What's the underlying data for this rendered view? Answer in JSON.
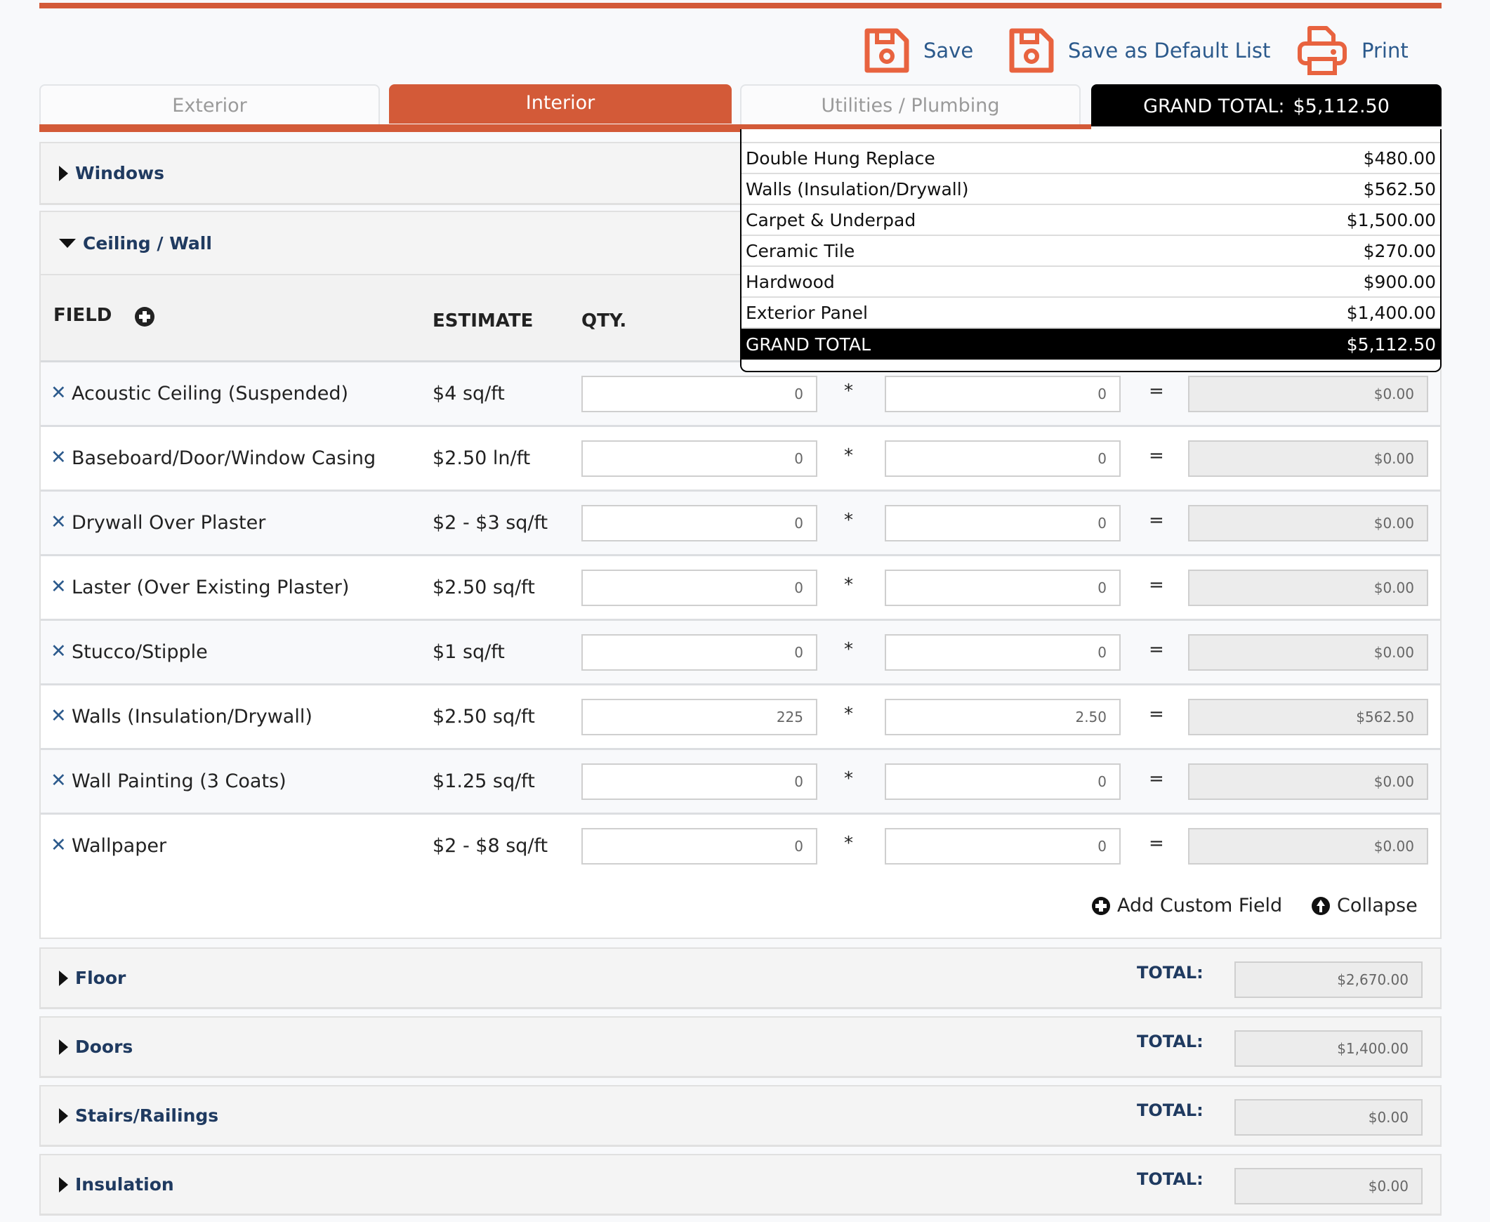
{
  "toolbar": {
    "save_label": "Save",
    "save_default_label": "Save as Default List",
    "print_label": "Print"
  },
  "colors": {
    "accent": "#d35a38",
    "link": "#2c5a8c",
    "heading": "#1f3a60"
  },
  "tabs": [
    {
      "label": "Exterior",
      "active": false
    },
    {
      "label": "Interior",
      "active": true
    },
    {
      "label": "Utilities / Plumbing",
      "active": false
    }
  ],
  "grand_total": {
    "label": "GRAND TOTAL:",
    "value": "$5,112.50"
  },
  "summary_popup": {
    "items": [
      {
        "name": "Double Hung Replace",
        "amount": "$480.00"
      },
      {
        "name": "Walls (Insulation/Drywall)",
        "amount": "$562.50"
      },
      {
        "name": "Carpet & Underpad",
        "amount": "$1,500.00"
      },
      {
        "name": "Ceramic Tile",
        "amount": "$270.00"
      },
      {
        "name": "Hardwood",
        "amount": "$900.00"
      },
      {
        "name": "Exterior Panel",
        "amount": "$1,400.00"
      }
    ],
    "total_label": "GRAND TOTAL",
    "total_value": "$5,112.50"
  },
  "sections": {
    "windows": {
      "title": "Windows"
    },
    "ceiling_wall": {
      "title": "Ceiling / Wall",
      "headers": {
        "field": "FIELD",
        "estimate": "ESTIMATE",
        "qty": "QTY."
      },
      "rows": [
        {
          "name": "Acoustic Ceiling (Suspended)",
          "estimate": "$4 sq/ft",
          "qty": "0",
          "price": "0",
          "total": "$0.00"
        },
        {
          "name": "Baseboard/Door/Window Casing",
          "estimate": "$2.50 ln/ft",
          "qty": "0",
          "price": "0",
          "total": "$0.00"
        },
        {
          "name": "Drywall Over Plaster",
          "estimate": "$2 - $3 sq/ft",
          "qty": "0",
          "price": "0",
          "total": "$0.00"
        },
        {
          "name": "Laster (Over Existing Plaster)",
          "estimate": "$2.50 sq/ft",
          "qty": "0",
          "price": "0",
          "total": "$0.00"
        },
        {
          "name": "Stucco/Stipple",
          "estimate": "$1 sq/ft",
          "qty": "0",
          "price": "0",
          "total": "$0.00"
        },
        {
          "name": "Walls (Insulation/Drywall)",
          "estimate": "$2.50 sq/ft",
          "qty": "225",
          "price": "2.50",
          "total": "$562.50"
        },
        {
          "name": "Wall Painting (3 Coats)",
          "estimate": "$1.25 sq/ft",
          "qty": "0",
          "price": "0",
          "total": "$0.00"
        },
        {
          "name": "Wallpaper",
          "estimate": "$2 - $8 sq/ft",
          "qty": "0",
          "price": "0",
          "total": "$0.00"
        }
      ],
      "operators": {
        "multiply": "*",
        "equals": "="
      },
      "add_custom_label": "Add Custom Field",
      "collapse_label": "Collapse"
    },
    "collapsed": [
      {
        "title": "Floor",
        "total_label": "TOTAL:",
        "total": "$2,670.00"
      },
      {
        "title": "Doors",
        "total_label": "TOTAL:",
        "total": "$1,400.00"
      },
      {
        "title": "Stairs/Railings",
        "total_label": "TOTAL:",
        "total": "$0.00"
      },
      {
        "title": "Insulation",
        "total_label": "TOTAL:",
        "total": "$0.00"
      }
    ]
  }
}
